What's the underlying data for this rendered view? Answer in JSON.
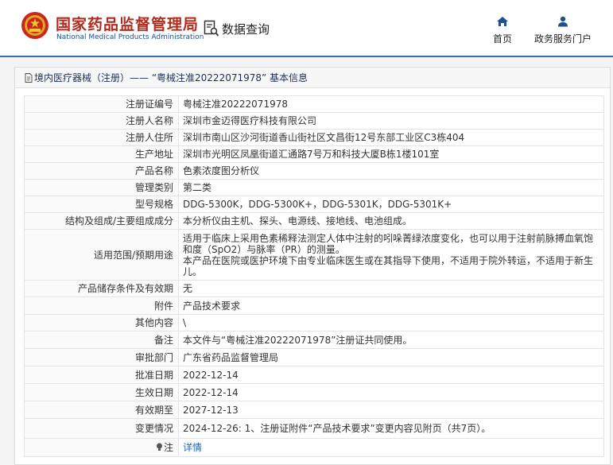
{
  "header": {
    "title_cn": "国家药品监督管理局",
    "title_en": "National Medical Products Administration",
    "query_label": "数据查询",
    "nav": [
      {
        "label": "首页",
        "icon": "home-icon"
      },
      {
        "label": "政务服务门户",
        "icon": "person-icon"
      }
    ]
  },
  "breadcrumb": {
    "text": "境内医疗器械（注册）——  “粤械注准20222071978”  基本信息"
  },
  "table": {
    "rows": [
      {
        "label": "注册证编号",
        "value": "粤械注准20222071978"
      },
      {
        "label": "注册人名称",
        "value": "深圳市金迈得医疗科技有限公司"
      },
      {
        "label": "注册人住所",
        "value": "深圳市南山区沙河街道香山街社区文昌街12号东部工业区C3栋404"
      },
      {
        "label": "生产地址",
        "value": "深圳市光明区凤凰街道汇通路7号万和科技大厦B栋1楼101室"
      },
      {
        "label": "产品名称",
        "value": "色素浓度图分析仪"
      },
      {
        "label": "管理类别",
        "value": "第二类"
      },
      {
        "label": "型号规格",
        "value": "DDG-5300K，DDG-5300K+，DDG-5301K，DDG-5301K+"
      },
      {
        "label": "结构及组成/主要组成成分",
        "value": "本分析仪由主机、探头、电源线、接地线、电池组成。"
      },
      {
        "label": "适用范围/预期用途",
        "value": "适用于临床上采用色素稀释法测定人体中注射的吲哚菁绿浓度变化，也可以用于注射前脉搏血氧饱和度（SpO2）与脉率（PR）的测量。\n本产品在医院或医护环境下由专业临床医生或在其指导下使用，不适用于院外转运，不适用于新生儿。"
      },
      {
        "label": "产品储存条件及有效期",
        "value": "无"
      },
      {
        "label": "附件",
        "value": "产品技术要求"
      },
      {
        "label": "其他内容",
        "value": "\\"
      },
      {
        "label": "备注",
        "value": "本文件与“粤械注准20222071978”注册证共同使用。"
      },
      {
        "label": "审批部门",
        "value": "广东省药品监督管理局"
      },
      {
        "label": "批准日期",
        "value": "2022-12-14"
      },
      {
        "label": "生效日期",
        "value": "2022-12-14"
      },
      {
        "label": "有效期至",
        "value": "2027-12-13"
      },
      {
        "label": "变更情况",
        "value": "2024-12-26: 1、注册证附件“产品技术要求”变更内容见附页（共7页）。"
      },
      {
        "label": "注",
        "value": "详情"
      }
    ]
  },
  "colors": {
    "brand_red": "#b22b1e",
    "brand_blue": "#1c4f8c",
    "nav_blue": "#1e4f8f",
    "link_blue": "#1a66b3",
    "header_line": "#3a6ea5"
  }
}
